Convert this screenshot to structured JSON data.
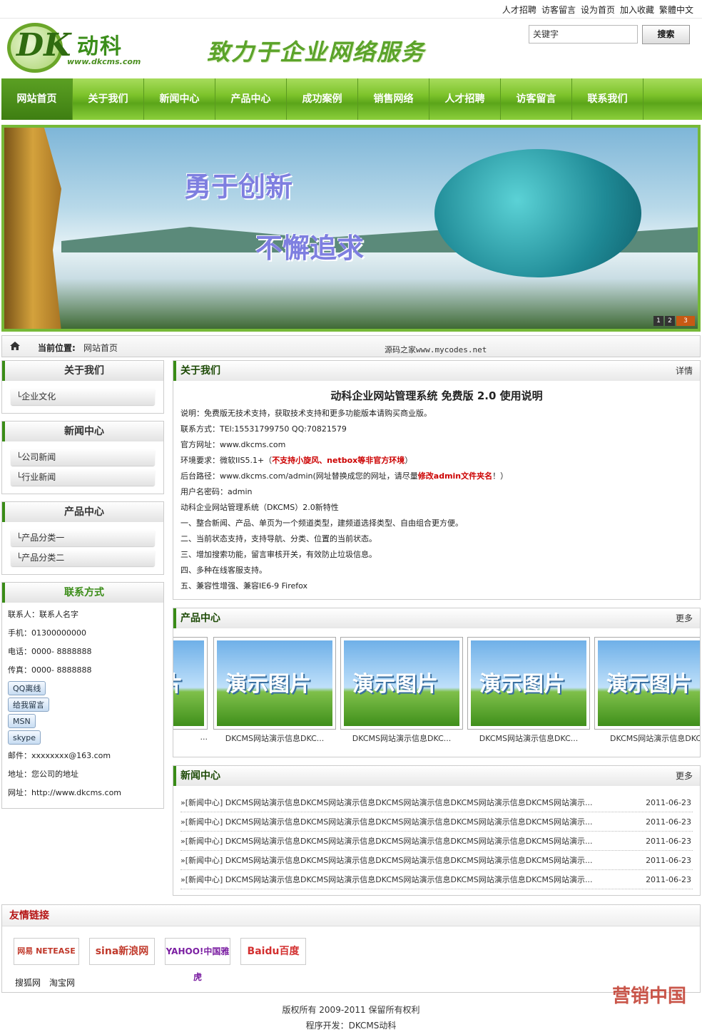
{
  "toplinks": [
    "人才招聘",
    "访客留言",
    "设为首页",
    "加入收藏",
    "繁體中文"
  ],
  "logo": {
    "name": "动科",
    "url": "www.dkcms.com",
    "letters": "DK"
  },
  "slogan": "致力于企业网络服务",
  "search": {
    "value": "关键字",
    "button": "搜索"
  },
  "nav": [
    "网站首页",
    "关于我们",
    "新闻中心",
    "产品中心",
    "成功案例",
    "销售网络",
    "人才招聘",
    "访客留言",
    "联系我们"
  ],
  "banner": {
    "text1": "勇于创新",
    "text2": "不懈追求",
    "dots": [
      "1",
      "2",
      "3"
    ]
  },
  "breadcrumb": {
    "label": "当前位置:",
    "value": "网站首页",
    "note": "源码之家www.mycodes.net"
  },
  "sidebar": {
    "about": {
      "title": "关于我们",
      "items": [
        "└企业文化"
      ]
    },
    "news": {
      "title": "新闻中心",
      "items": [
        "└公司新闻",
        "└行业新闻"
      ]
    },
    "products": {
      "title": "产品中心",
      "items": [
        "└产品分类一",
        "└产品分类二"
      ]
    },
    "contact": {
      "title": "联系方式",
      "lines": [
        "联系人：联系人名字",
        "手机：01300000000",
        "电话：0000- 8888888",
        "传真：0000- 8888888"
      ],
      "buttons": [
        "QQ离线",
        "给我留言",
        "MSN",
        "skype"
      ],
      "lines2": [
        "邮件：xxxxxxxx@163.com",
        "地址：您公司的地址",
        "网址：http://www.dkcms.com"
      ]
    }
  },
  "about": {
    "title": "关于我们",
    "more": "详情",
    "heading": "动科企业网站管理系统 免费版 2.0 使用说明",
    "lines": [
      "说明：免费版无技术支持，获取技术支持和更多功能版本请购买商业版。",
      "联系方式：TEl:15531799750 QQ:70821579",
      "官方网址：www.dkcms.com"
    ],
    "env_prefix": "环境要求：微软IIS5.1+（",
    "env_red": "不支持小旋风、netbox等非官方环境",
    "env_suffix": "）",
    "path_prefix": "后台路径：www.dkcms.com/admin(网址替换成您的网址，请尽量",
    "path_red": "修改admin文件夹名",
    "path_suffix": "！）",
    "lines2": [
      "用户名密码：admin",
      "动科企业网站管理系统（DKCMS）2.0新特性",
      "一、整合新闻、产品、单页为一个频道类型，建频道选择类型、自由组合更方便。",
      "二、当前状态支持，支持导航、分类、位置的当前状态。",
      "三、增加搜索功能，留言审核开关，有效防止垃圾信息。",
      "四、多种在线客服支持。",
      "五、兼容性增强、兼容IE6-9 Firefox"
    ]
  },
  "products": {
    "title": "产品中心",
    "more": "更多",
    "image_text": "演示图片",
    "captions": [
      "...",
      "DKCMS网站演示信息DKC...",
      "DKCMS网站演示信息DKC...",
      "DKCMS网站演示信息DKC...",
      "DKCMS网站演示信息DKC"
    ]
  },
  "news": {
    "title": "新闻中心",
    "more": "更多",
    "items": [
      {
        "text": "»[新闻中心] DKCMS网站演示信息DKCMS网站演示信息DKCMS网站演示信息DKCMS网站演示信息DKCMS网站演示...",
        "date": "2011-06-23"
      },
      {
        "text": "»[新闻中心] DKCMS网站演示信息DKCMS网站演示信息DKCMS网站演示信息DKCMS网站演示信息DKCMS网站演示...",
        "date": "2011-06-23"
      },
      {
        "text": "»[新闻中心] DKCMS网站演示信息DKCMS网站演示信息DKCMS网站演示信息DKCMS网站演示信息DKCMS网站演示...",
        "date": "2011-06-23"
      },
      {
        "text": "»[新闻中心] DKCMS网站演示信息DKCMS网站演示信息DKCMS网站演示信息DKCMS网站演示信息DKCMS网站演示...",
        "date": "2011-06-23"
      },
      {
        "text": "»[新闻中心] DKCMS网站演示信息DKCMS网站演示信息DKCMS网站演示信息DKCMS网站演示信息DKCMS网站演示...",
        "date": "2011-06-23"
      }
    ]
  },
  "links": {
    "title": "友情链接",
    "logos": [
      "网易 NETEASE",
      "sina新浪网",
      "YAHOO!中国雅虎",
      "Baidu百度"
    ],
    "text": [
      "搜狐网",
      "淘宝网"
    ]
  },
  "footer": {
    "line1": "版权所有 2009-2011 保留所有权利",
    "line2": "程序开发：DKCMS动科"
  },
  "watermark": "营销中国"
}
